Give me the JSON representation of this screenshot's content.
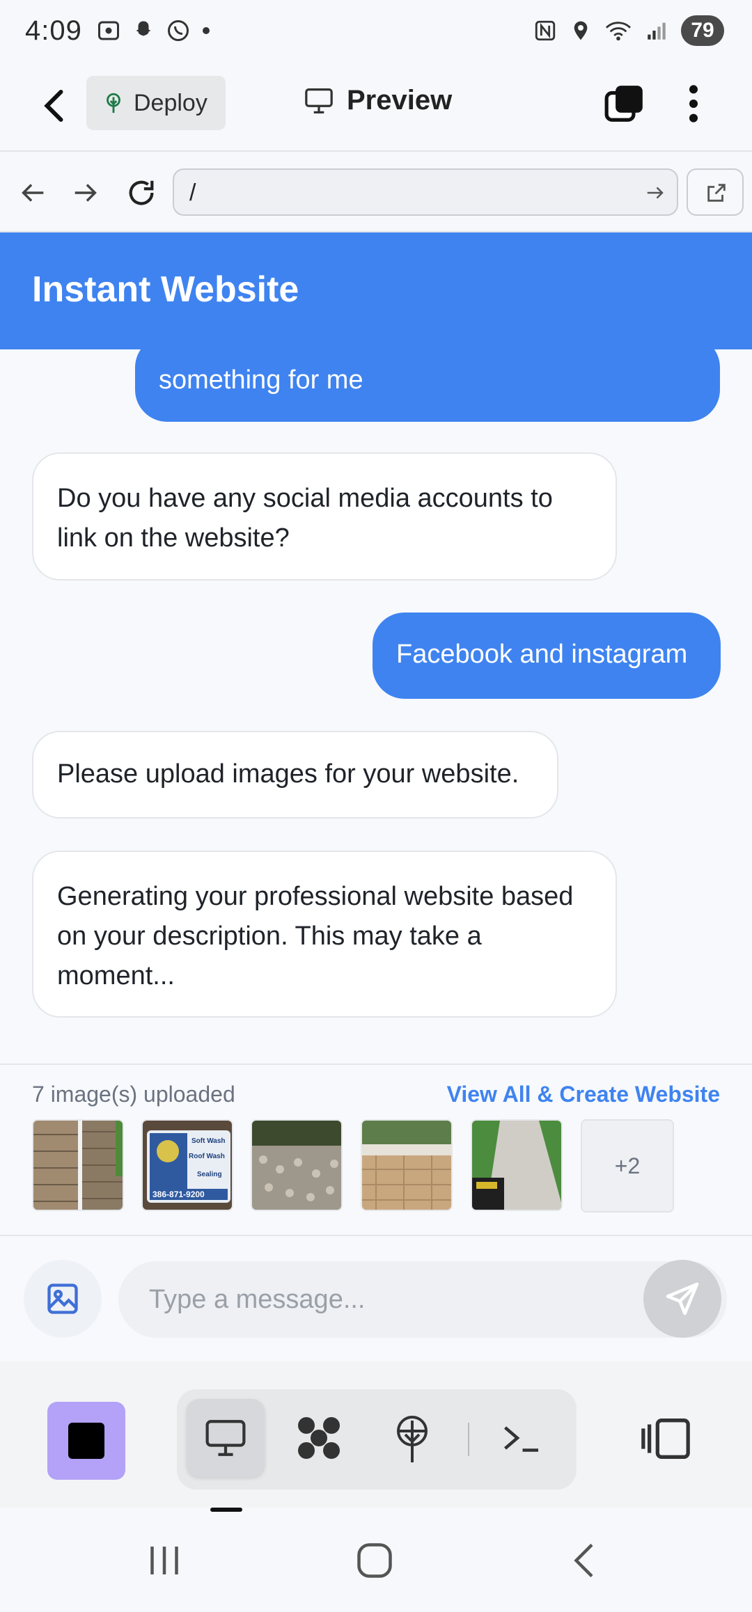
{
  "status_bar": {
    "time": "4:09",
    "battery": "79"
  },
  "app_bar": {
    "deploy_label": "Deploy",
    "preview_label": "Preview"
  },
  "browser": {
    "url": "/"
  },
  "site": {
    "title": "Instant Website"
  },
  "chat": {
    "messages": [
      {
        "role": "user",
        "text": "something for me"
      },
      {
        "role": "bot",
        "text": "Do you have any social media accounts to link on the website?"
      },
      {
        "role": "user",
        "text": "Facebook and instagram"
      },
      {
        "role": "bot",
        "text": "Please upload images for your website."
      },
      {
        "role": "bot",
        "text": "Generating your professional website based on your description. This may take a moment..."
      }
    ]
  },
  "uploads": {
    "count_label": "7 image(s) uploaded",
    "view_all_label": "View All & Create Website",
    "more_label": "+2",
    "thumb_sign_lines": [
      "Soft Wash",
      "Roof Wash",
      "Sealing",
      "386-871-9200"
    ]
  },
  "composer": {
    "placeholder": "Type a message..."
  },
  "colors": {
    "accent": "#3f83f0",
    "stop": "#b3a2f7"
  }
}
